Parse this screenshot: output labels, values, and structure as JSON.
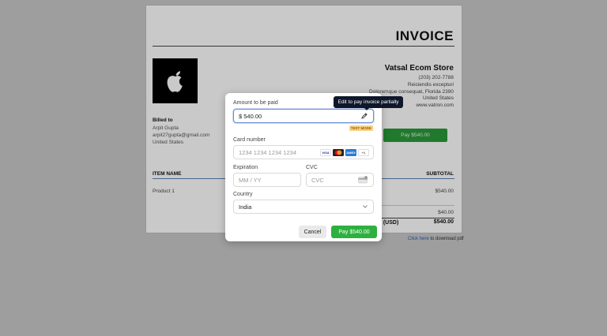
{
  "invoice": {
    "title": "INVOICE",
    "store": {
      "name": "Vatsal Ecom Store",
      "phone": "(203) 202-7788",
      "address1": "Reiciendis excepturi",
      "address2": "Doloremque consequat, Florida 2390",
      "country": "United States",
      "website": "www.vatron.com"
    },
    "billed": {
      "title": "Billed to",
      "name": "Arpit Gupta",
      "email": "arpit27gupta@gmail.com",
      "country": "United States"
    },
    "pay_button": "Pay $540.00",
    "table": {
      "col_item": "ITEM NAME",
      "col_subtotal": "SUBTOTAL",
      "rows": [
        {
          "name": "Product 1",
          "amount": "$540.00"
        }
      ],
      "sum_amount": "$40.00",
      "total_label": "e (USD)",
      "total_amount": "$540.00"
    },
    "download": {
      "link": "Click here",
      "text": " to download pdf"
    }
  },
  "modal": {
    "amount_label": "Amount to be paid",
    "amount_value": "$ 540.00",
    "test_mode": "TEST MODE",
    "card_label": "Card number",
    "card_placeholder": "1234 1234 1234 1234",
    "card_brands": {
      "visa": "VISA",
      "amex": "AMEX",
      "more": "+1"
    },
    "expiration_label": "Expiration",
    "expiration_placeholder": "MM / YY",
    "cvc_label": "CVC",
    "cvc_placeholder": "CVC",
    "country_label": "Country",
    "country_value": "India",
    "cancel": "Cancel",
    "pay": "Pay $540.00"
  },
  "tooltip": "Edit to pay invoice partially",
  "colors": {
    "pay_green": "#2eb03f",
    "tooltip_bg": "#0f172a",
    "accent_blue": "#6b8ed6"
  }
}
